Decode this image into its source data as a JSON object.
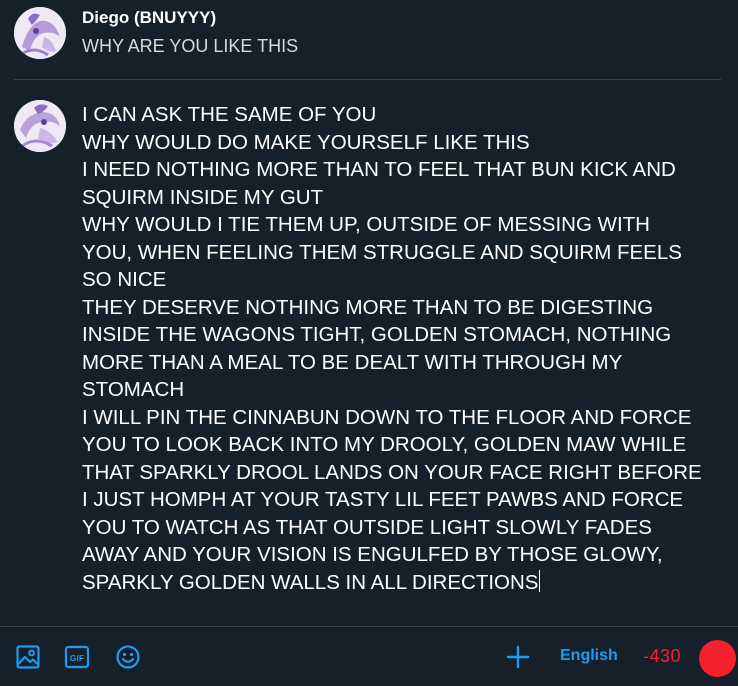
{
  "reply_context": {
    "author_name": "Diego (BNUYYY)",
    "text": "WHY ARE YOU LIKE THIS"
  },
  "compose": {
    "lines": [
      "I CAN ASK THE SAME OF YOU",
      "WHY WOULD DO MAKE YOURSELF LIKE THIS",
      "I NEED NOTHING MORE THAN TO FEEL THAT BUN KICK AND",
      "SQUIRM INSIDE MY GUT",
      "WHY WOULD I TIE THEM UP, OUTSIDE OF MESSING WITH",
      "YOU, WHEN FEELING THEM STRUGGLE AND SQUIRM FEELS",
      "SO NICE",
      "THEY DESERVE NOTHING MORE THAN TO BE DIGESTING",
      "INSIDE THE WAGONS TIGHT, GOLDEN STOMACH, NOTHING",
      "MORE THAN A MEAL TO BE DEALT WITH THROUGH MY",
      "STOMACH",
      "I WILL PIN THE CINNABUN DOWN TO THE FLOOR AND FORCE",
      "YOU TO LOOK BACK INTO MY DROOLY, GOLDEN MAW WHILE",
      "THAT SPARKLY DROOL LANDS ON YOUR FACE RIGHT BEFORE",
      "I JUST HOMPH AT YOUR TASTY LIL FEET PAWBS AND FORCE",
      "YOU TO WATCH AS THAT OUTSIDE LIGHT SLOWLY FADES",
      "AWAY AND YOUR VISION IS ENGULFED BY THOSE GLOWY,",
      "SPARKLY GOLDEN WALLS IN ALL DIRECTIONS"
    ]
  },
  "toolbar": {
    "icons": [
      "image-icon",
      "gif-icon",
      "emoji-icon",
      "plus-icon"
    ],
    "gif_label": "GIF",
    "language": "English",
    "char_counter": "-430",
    "char_progress": 1.0
  },
  "colors": {
    "background": "#15202b",
    "divider": "#38444d",
    "accent": "#1d9bf0",
    "error": "#f4212e",
    "text": "#ffffff"
  }
}
